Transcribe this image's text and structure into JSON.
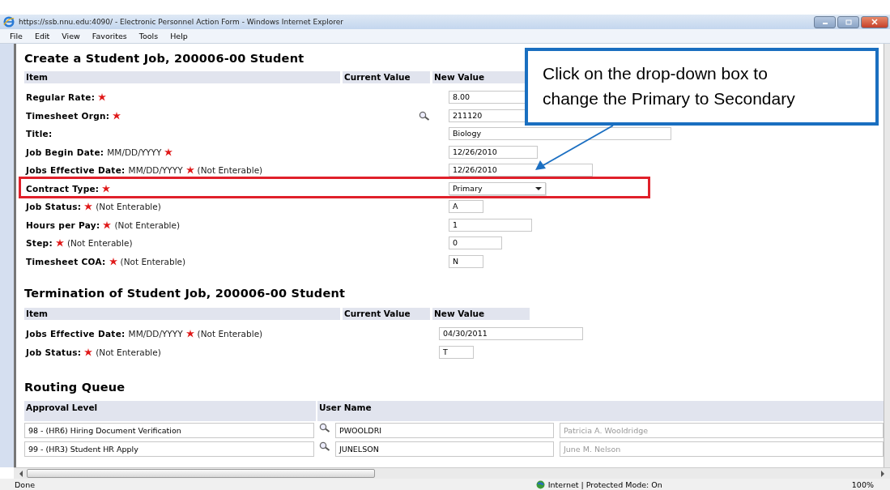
{
  "window": {
    "title": "https://ssb.nnu.edu:4090/ - Electronic Personnel Action Form - Windows Internet Explorer"
  },
  "menu": [
    "File",
    "Edit",
    "View",
    "Favorites",
    "Tools",
    "Help"
  ],
  "create": {
    "title": "Create a Student Job, 200006-00 Student",
    "columns": [
      "Item",
      "Current Value",
      "New Value"
    ],
    "rows": [
      {
        "label": "Regular Rate:",
        "required": true,
        "kind": "text",
        "value": "8.00",
        "highlighted": false
      },
      {
        "label": "Timesheet Orgn:",
        "required": true,
        "kind": "lookup",
        "value": "211120",
        "highlighted": false
      },
      {
        "label": "Title:",
        "required": false,
        "kind": "text",
        "value": "Biology",
        "highlighted": false
      },
      {
        "label": "Job Begin Date:",
        "format": "MM/DD/YYYY",
        "required": true,
        "kind": "text",
        "value": "12/26/2010",
        "highlighted": false
      },
      {
        "label": "Jobs Effective Date:",
        "format": "MM/DD/YYYY",
        "required": true,
        "note": "(Not Enterable)",
        "kind": "text",
        "value": "12/26/2010",
        "highlighted": false
      },
      {
        "label": "Contract Type:",
        "required": true,
        "kind": "select",
        "value": "Primary",
        "highlighted": true
      },
      {
        "label": "Job Status:",
        "required": true,
        "note": "(Not Enterable)",
        "kind": "text",
        "value": "A",
        "highlighted": false
      },
      {
        "label": "Hours per Pay:",
        "required": true,
        "note": "(Not Enterable)",
        "kind": "text",
        "value": "1",
        "highlighted": false
      },
      {
        "label": "Step:",
        "required": true,
        "note": "(Not Enterable)",
        "kind": "text",
        "value": "0",
        "highlighted": false
      },
      {
        "label": "Timesheet COA:",
        "required": true,
        "note": "(Not Enterable)",
        "kind": "text",
        "value": "N",
        "highlighted": false
      }
    ]
  },
  "termination": {
    "title": "Termination of Student Job, 200006-00 Student",
    "columns": [
      "Item",
      "Current Value",
      "New Value"
    ],
    "rows": [
      {
        "label": "Jobs Effective Date:",
        "format": "MM/DD/YYYY",
        "required": true,
        "note": "(Not Enterable)",
        "value": "04/30/2011",
        "highlighted": false
      },
      {
        "label": "Job Status:",
        "required": true,
        "note": "(Not Enterable)",
        "value": "T",
        "highlighted": false
      }
    ]
  },
  "routing": {
    "title": "Routing Queue",
    "columns": [
      "Approval Level",
      "User Name"
    ],
    "rows": [
      {
        "level": "98 - (HR6) Hiring Document Verification",
        "user": "PWOOLDRI",
        "full_name": "Patricia A. Wooldridge"
      },
      {
        "level": "99 - (HR3) Student HR Apply",
        "user": "JUNELSON",
        "full_name": "June M. Nelson"
      }
    ]
  },
  "callout": {
    "text": "Click on the drop-down box to change the Primary to Secondary"
  },
  "status_bar": {
    "text": "Done",
    "zone": "Internet | Protected Mode: On",
    "zoom": "100%"
  }
}
